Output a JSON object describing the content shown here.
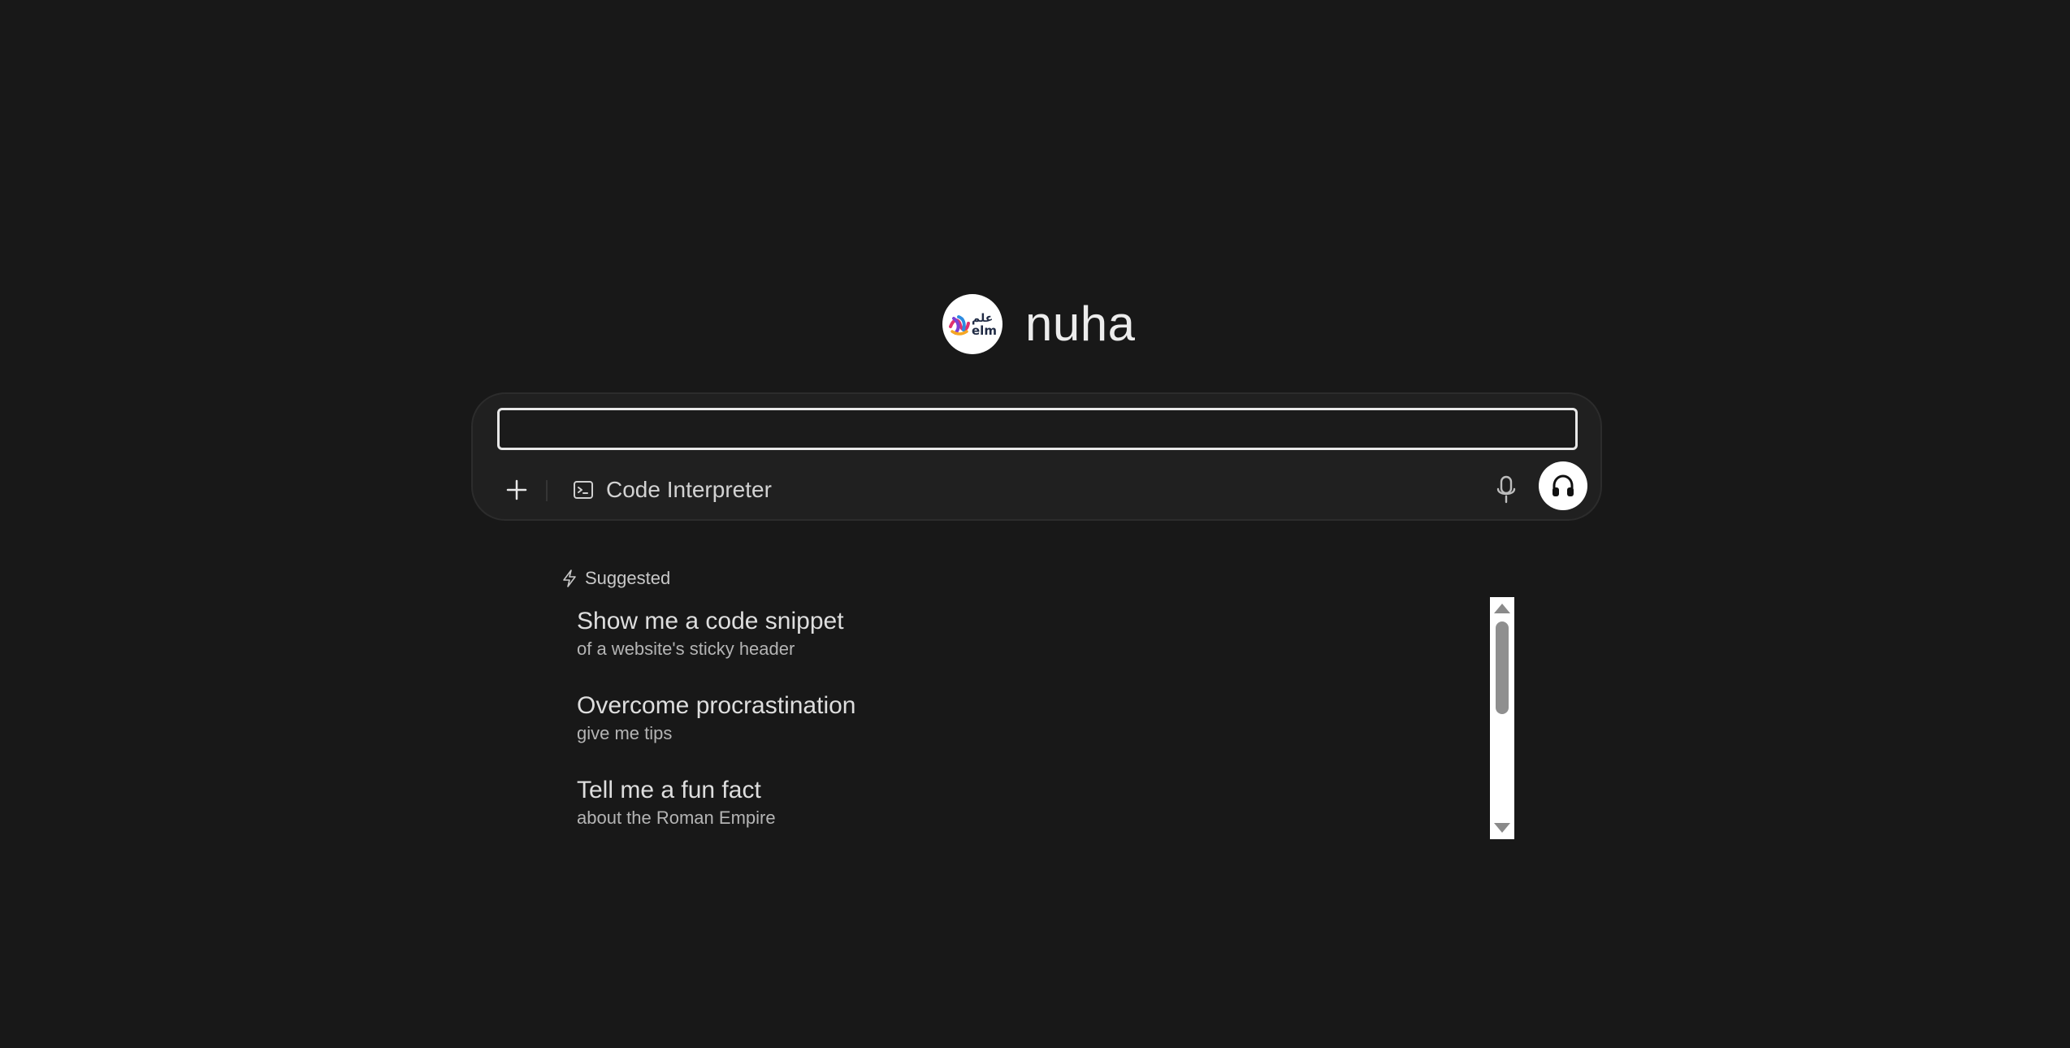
{
  "brand": {
    "logo_text_arabic": "علم",
    "logo_text_latin": "elm",
    "name": "nuha"
  },
  "composer": {
    "input_value": "",
    "input_placeholder": "",
    "add_icon": "plus-icon",
    "tool": {
      "icon": "terminal-icon",
      "label": "Code Interpreter"
    },
    "mic_icon": "microphone-icon",
    "voice_icon": "headphones-icon"
  },
  "suggestions": {
    "title": "Suggested",
    "icon": "bolt-icon",
    "items": [
      {
        "title": "Show me a code snippet",
        "subtitle": "of a website's sticky header"
      },
      {
        "title": "Overcome procrastination",
        "subtitle": "give me tips"
      },
      {
        "title": "Tell me a fun fact",
        "subtitle": "about the Roman Empire"
      }
    ]
  },
  "colors": {
    "background": "#181818",
    "card": "#202020",
    "text": "#e6e6e6"
  }
}
